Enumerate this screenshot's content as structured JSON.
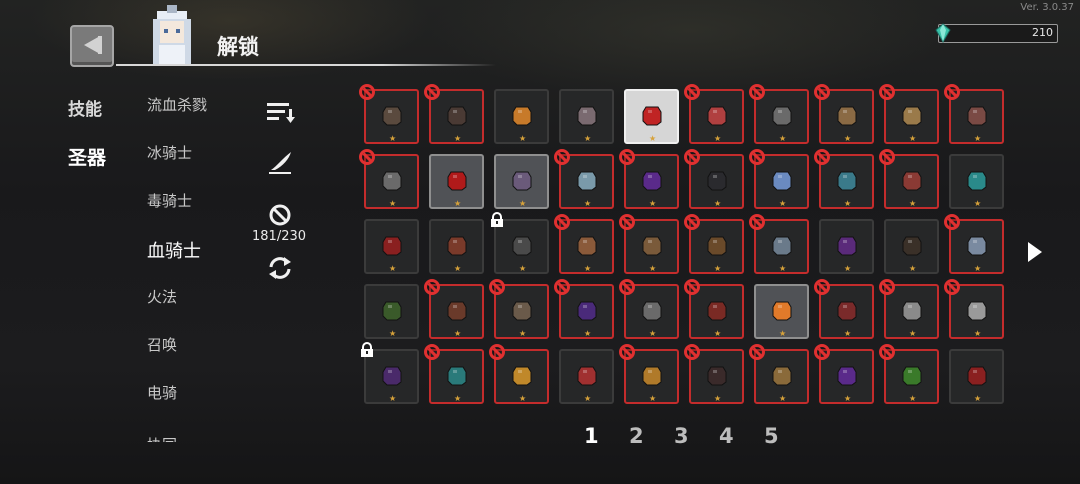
{
  "version": "Ver. 3.0.37",
  "header": {
    "title": "解锁"
  },
  "currency": {
    "amount": "210",
    "icon": "gem-icon"
  },
  "categories": [
    {
      "label": "技能",
      "active": false
    },
    {
      "label": "圣器",
      "active": true
    }
  ],
  "subcategories": [
    {
      "label": "流血杀戮"
    },
    {
      "label": "冰骑士"
    },
    {
      "label": "毒骑士"
    },
    {
      "label": "血骑士",
      "active": true
    },
    {
      "label": "火法"
    },
    {
      "label": "召唤"
    },
    {
      "label": "电骑"
    },
    {
      "label": "协同"
    }
  ],
  "tools": {
    "count": "181/230",
    "icons": [
      "sort-icon",
      "quill-icon",
      "ban-filter-icon",
      "refresh-icon"
    ]
  },
  "grid": {
    "rows": [
      [
        {
          "s": "locked",
          "icon": "stone-disc-icon",
          "c": "#5a4a3e"
        },
        {
          "s": "locked",
          "icon": "pouch-icon",
          "c": "#4a3a34"
        },
        {
          "s": "normal",
          "icon": "amber-crystal-icon",
          "c": "#c77a2a"
        },
        {
          "s": "normal",
          "icon": "feather-icon",
          "c": "#7a6a70"
        },
        {
          "s": "highlight",
          "icon": "red-potion-icon",
          "c": "#c02424"
        },
        {
          "s": "locked",
          "icon": "demon-mask-icon",
          "c": "#b04040"
        },
        {
          "s": "locked",
          "icon": "skull-icon",
          "c": "#6a6a6a"
        },
        {
          "s": "locked",
          "icon": "paper-bag-icon",
          "c": "#8a6a44"
        },
        {
          "s": "locked",
          "icon": "paper-bag-icon",
          "c": "#9a7a4a"
        },
        {
          "s": "locked",
          "icon": "meat-icon",
          "c": "#7a4a44"
        }
      ],
      [
        {
          "s": "locked",
          "icon": "sparkle-icon",
          "c": "#6a6a6a"
        },
        {
          "s": "selected",
          "icon": "bat-emblem-icon",
          "c": "#b01a1a"
        },
        {
          "s": "selected",
          "icon": "purple-stone-icon",
          "c": "#6a5a7a"
        },
        {
          "s": "locked",
          "icon": "ice-shard-icon",
          "c": "#7a9aaa"
        },
        {
          "s": "locked",
          "icon": "purple-gem-icon",
          "c": "#5a2a8a"
        },
        {
          "s": "locked",
          "icon": "coal-icon",
          "c": "#2a2a2e"
        },
        {
          "s": "locked",
          "icon": "ice-fist-icon",
          "c": "#6a8ac0"
        },
        {
          "s": "locked",
          "icon": "mushroom-tree-icon",
          "c": "#3a7a8a"
        },
        {
          "s": "locked",
          "icon": "red-mushroom-icon",
          "c": "#8a3a34"
        },
        {
          "s": "normal",
          "icon": "teal-orbs-icon",
          "c": "#2a8a8a"
        }
      ],
      [
        {
          "s": "normal",
          "icon": "red-scarf-icon",
          "c": "#8a2020"
        },
        {
          "s": "normal",
          "icon": "clay-vase-icon",
          "c": "#7a3a2a"
        },
        {
          "s": "normal",
          "padlock": true,
          "icon": "spoon-icon",
          "c": "#4a4a4a"
        },
        {
          "s": "locked",
          "icon": "boot-icon",
          "c": "#8a5a3a"
        },
        {
          "s": "locked",
          "icon": "glove-icon",
          "c": "#7a5a3a"
        },
        {
          "s": "locked",
          "icon": "wood-plank-icon",
          "c": "#6a4a2a"
        },
        {
          "s": "locked",
          "icon": "crystal-ball-icon",
          "c": "#6a7a8a"
        },
        {
          "s": "normal",
          "icon": "purple-lantern-icon",
          "c": "#5a2a7a"
        },
        {
          "s": "normal",
          "icon": "dark-chest-icon",
          "c": "#3a3028"
        },
        {
          "s": "locked",
          "icon": "ice-cube-icon",
          "c": "#7a8aa0"
        }
      ],
      [
        {
          "s": "normal",
          "icon": "green-ring-icon",
          "c": "#3a5a2a"
        },
        {
          "s": "locked",
          "icon": "crossbow-icon",
          "c": "#6a3a2a"
        },
        {
          "s": "locked",
          "icon": "rock-golem-icon",
          "c": "#6a5a4a"
        },
        {
          "s": "locked",
          "icon": "purple-serpent-icon",
          "c": "#4a2a7a"
        },
        {
          "s": "locked",
          "icon": "crossed-swords-icon",
          "c": "#6a6a6a"
        },
        {
          "s": "locked",
          "icon": "heart-icon",
          "c": "#7a2a24"
        },
        {
          "s": "selected",
          "icon": "blue-scroll-icon",
          "c": "#e07a2a"
        },
        {
          "s": "locked",
          "icon": "red-feather-icon",
          "c": "#7a2a2a"
        },
        {
          "s": "locked",
          "icon": "dagger-icon",
          "c": "#8a8a8a"
        },
        {
          "s": "locked",
          "icon": "long-blade-icon",
          "c": "#9a9a9a"
        }
      ],
      [
        {
          "s": "normal",
          "padlock": true,
          "icon": "dark-orb-icon",
          "c": "#4a2a6a"
        },
        {
          "s": "locked",
          "icon": "teal-spider-icon",
          "c": "#2a7a7a"
        },
        {
          "s": "locked",
          "icon": "gold-bar-icon",
          "c": "#c0882a"
        },
        {
          "s": "normal",
          "icon": "red-boot-icon",
          "c": "#a03030"
        },
        {
          "s": "locked",
          "icon": "gold-coin-icon",
          "c": "#b07a2a"
        },
        {
          "s": "locked",
          "icon": "black-spider-icon",
          "c": "#3a2a2a"
        },
        {
          "s": "locked",
          "icon": "bronze-coin-icon",
          "c": "#8a6a3a"
        },
        {
          "s": "locked",
          "icon": "purple-jar-icon",
          "c": "#5a2a8a"
        },
        {
          "s": "locked",
          "icon": "green-berries-icon",
          "c": "#3a7a2a"
        },
        {
          "s": "normal",
          "icon": "red-meat-icon",
          "c": "#8a2020"
        }
      ]
    ]
  },
  "pagination": {
    "pages": [
      "1",
      "2",
      "3",
      "4",
      "5"
    ],
    "current": "1"
  },
  "colors": {
    "locked_border": "#c42c2c",
    "star": "#d7a23a",
    "accent": "#ffffff"
  }
}
